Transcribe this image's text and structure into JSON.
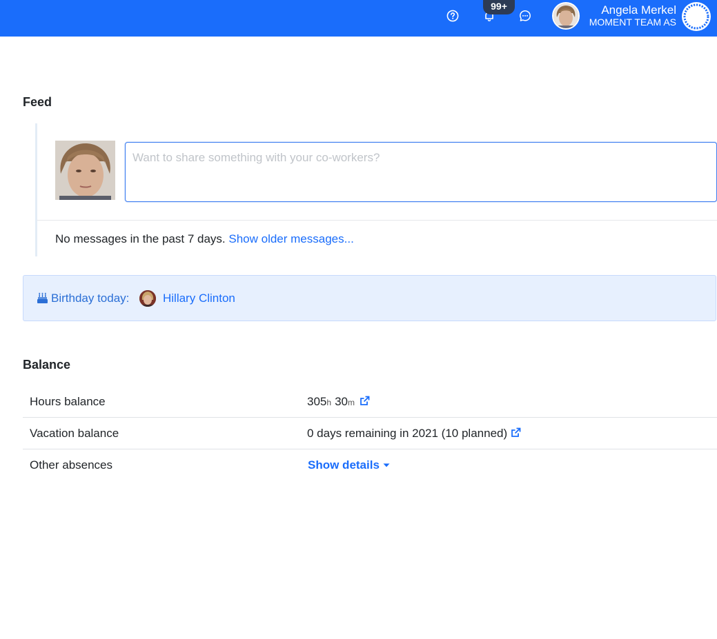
{
  "header": {
    "notification_count": "99+",
    "user_name": "Angela Merkel",
    "company": "MOMENT TEAM AS",
    "brand_color": "#1a6dfb",
    "icons": [
      "help-icon",
      "bell-icon",
      "chat-icon"
    ]
  },
  "feed": {
    "title": "Feed",
    "input_placeholder": "Want to share something with your co-workers?",
    "input_value": "",
    "no_messages_text": "No messages in the past 7 days.",
    "show_older_link": "Show older messages..."
  },
  "birthday": {
    "icon": "birthday-cake-icon",
    "label": "Birthday today:",
    "person": "Hillary Clinton"
  },
  "balance": {
    "title": "Balance",
    "rows": [
      {
        "label": "Hours balance",
        "hours": "305",
        "hours_unit": "h",
        "minutes": "30",
        "minutes_unit": "m"
      },
      {
        "label": "Vacation balance",
        "value": "0 days remaining in 2021 (10 planned)"
      },
      {
        "label": "Other absences",
        "action": "Show details"
      }
    ]
  }
}
